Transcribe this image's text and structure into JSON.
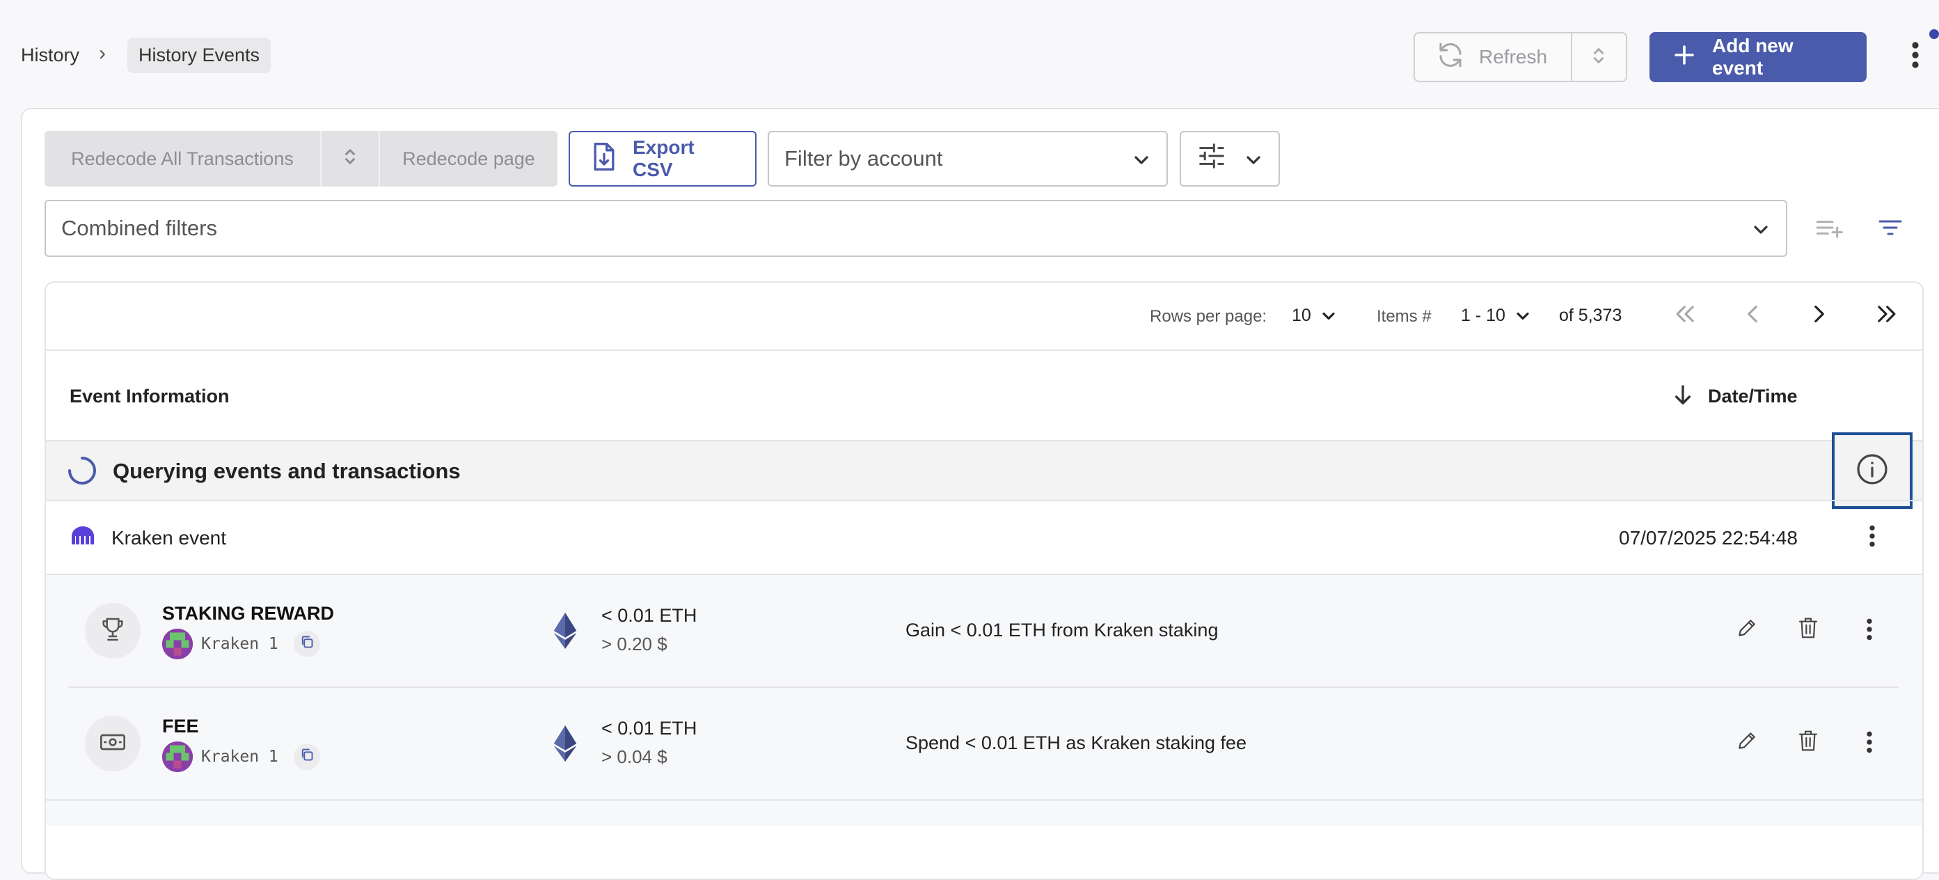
{
  "breadcrumb": {
    "parent": "History",
    "current": "History Events"
  },
  "toolbar": {
    "refresh_label": "Refresh",
    "add_event_label": "Add new event"
  },
  "actions": {
    "redecode_all_label": "Redecode All Transactions",
    "redecode_page_label": "Redecode page",
    "export_csv_label": "Export CSV",
    "filter_account_placeholder": "Filter by account",
    "combined_filters_placeholder": "Combined filters"
  },
  "pagination": {
    "rows_per_page_label": "Rows per page:",
    "rows_per_page_value": "10",
    "items_label": "Items #",
    "items_range": "1 - 10",
    "total": "of 5,373"
  },
  "table": {
    "col_event_info": "Event Information",
    "col_datetime": "Date/Time",
    "querying_text": "Querying events and transactions",
    "group": {
      "title": "Kraken event",
      "datetime": "07/07/2025 22:54:48"
    },
    "events": [
      {
        "type": "STAKING REWARD",
        "icon": "trophy-icon",
        "account": "Kraken 1",
        "asset_icon": "eth-icon",
        "amount": "< 0.01 ETH",
        "usd_value": "> 0.20 $",
        "description": "Gain < 0.01 ETH from Kraken staking"
      },
      {
        "type": "FEE",
        "icon": "money-icon",
        "account": "Kraken 1",
        "asset_icon": "eth-icon",
        "amount": "< 0.01 ETH",
        "usd_value": "> 0.04 $",
        "description": "Spend < 0.01 ETH as Kraken staking fee"
      }
    ]
  },
  "colors": {
    "primary": "#4b5bab",
    "highlight_border": "#1c4f93",
    "kraken_brand": "#5741d9"
  }
}
